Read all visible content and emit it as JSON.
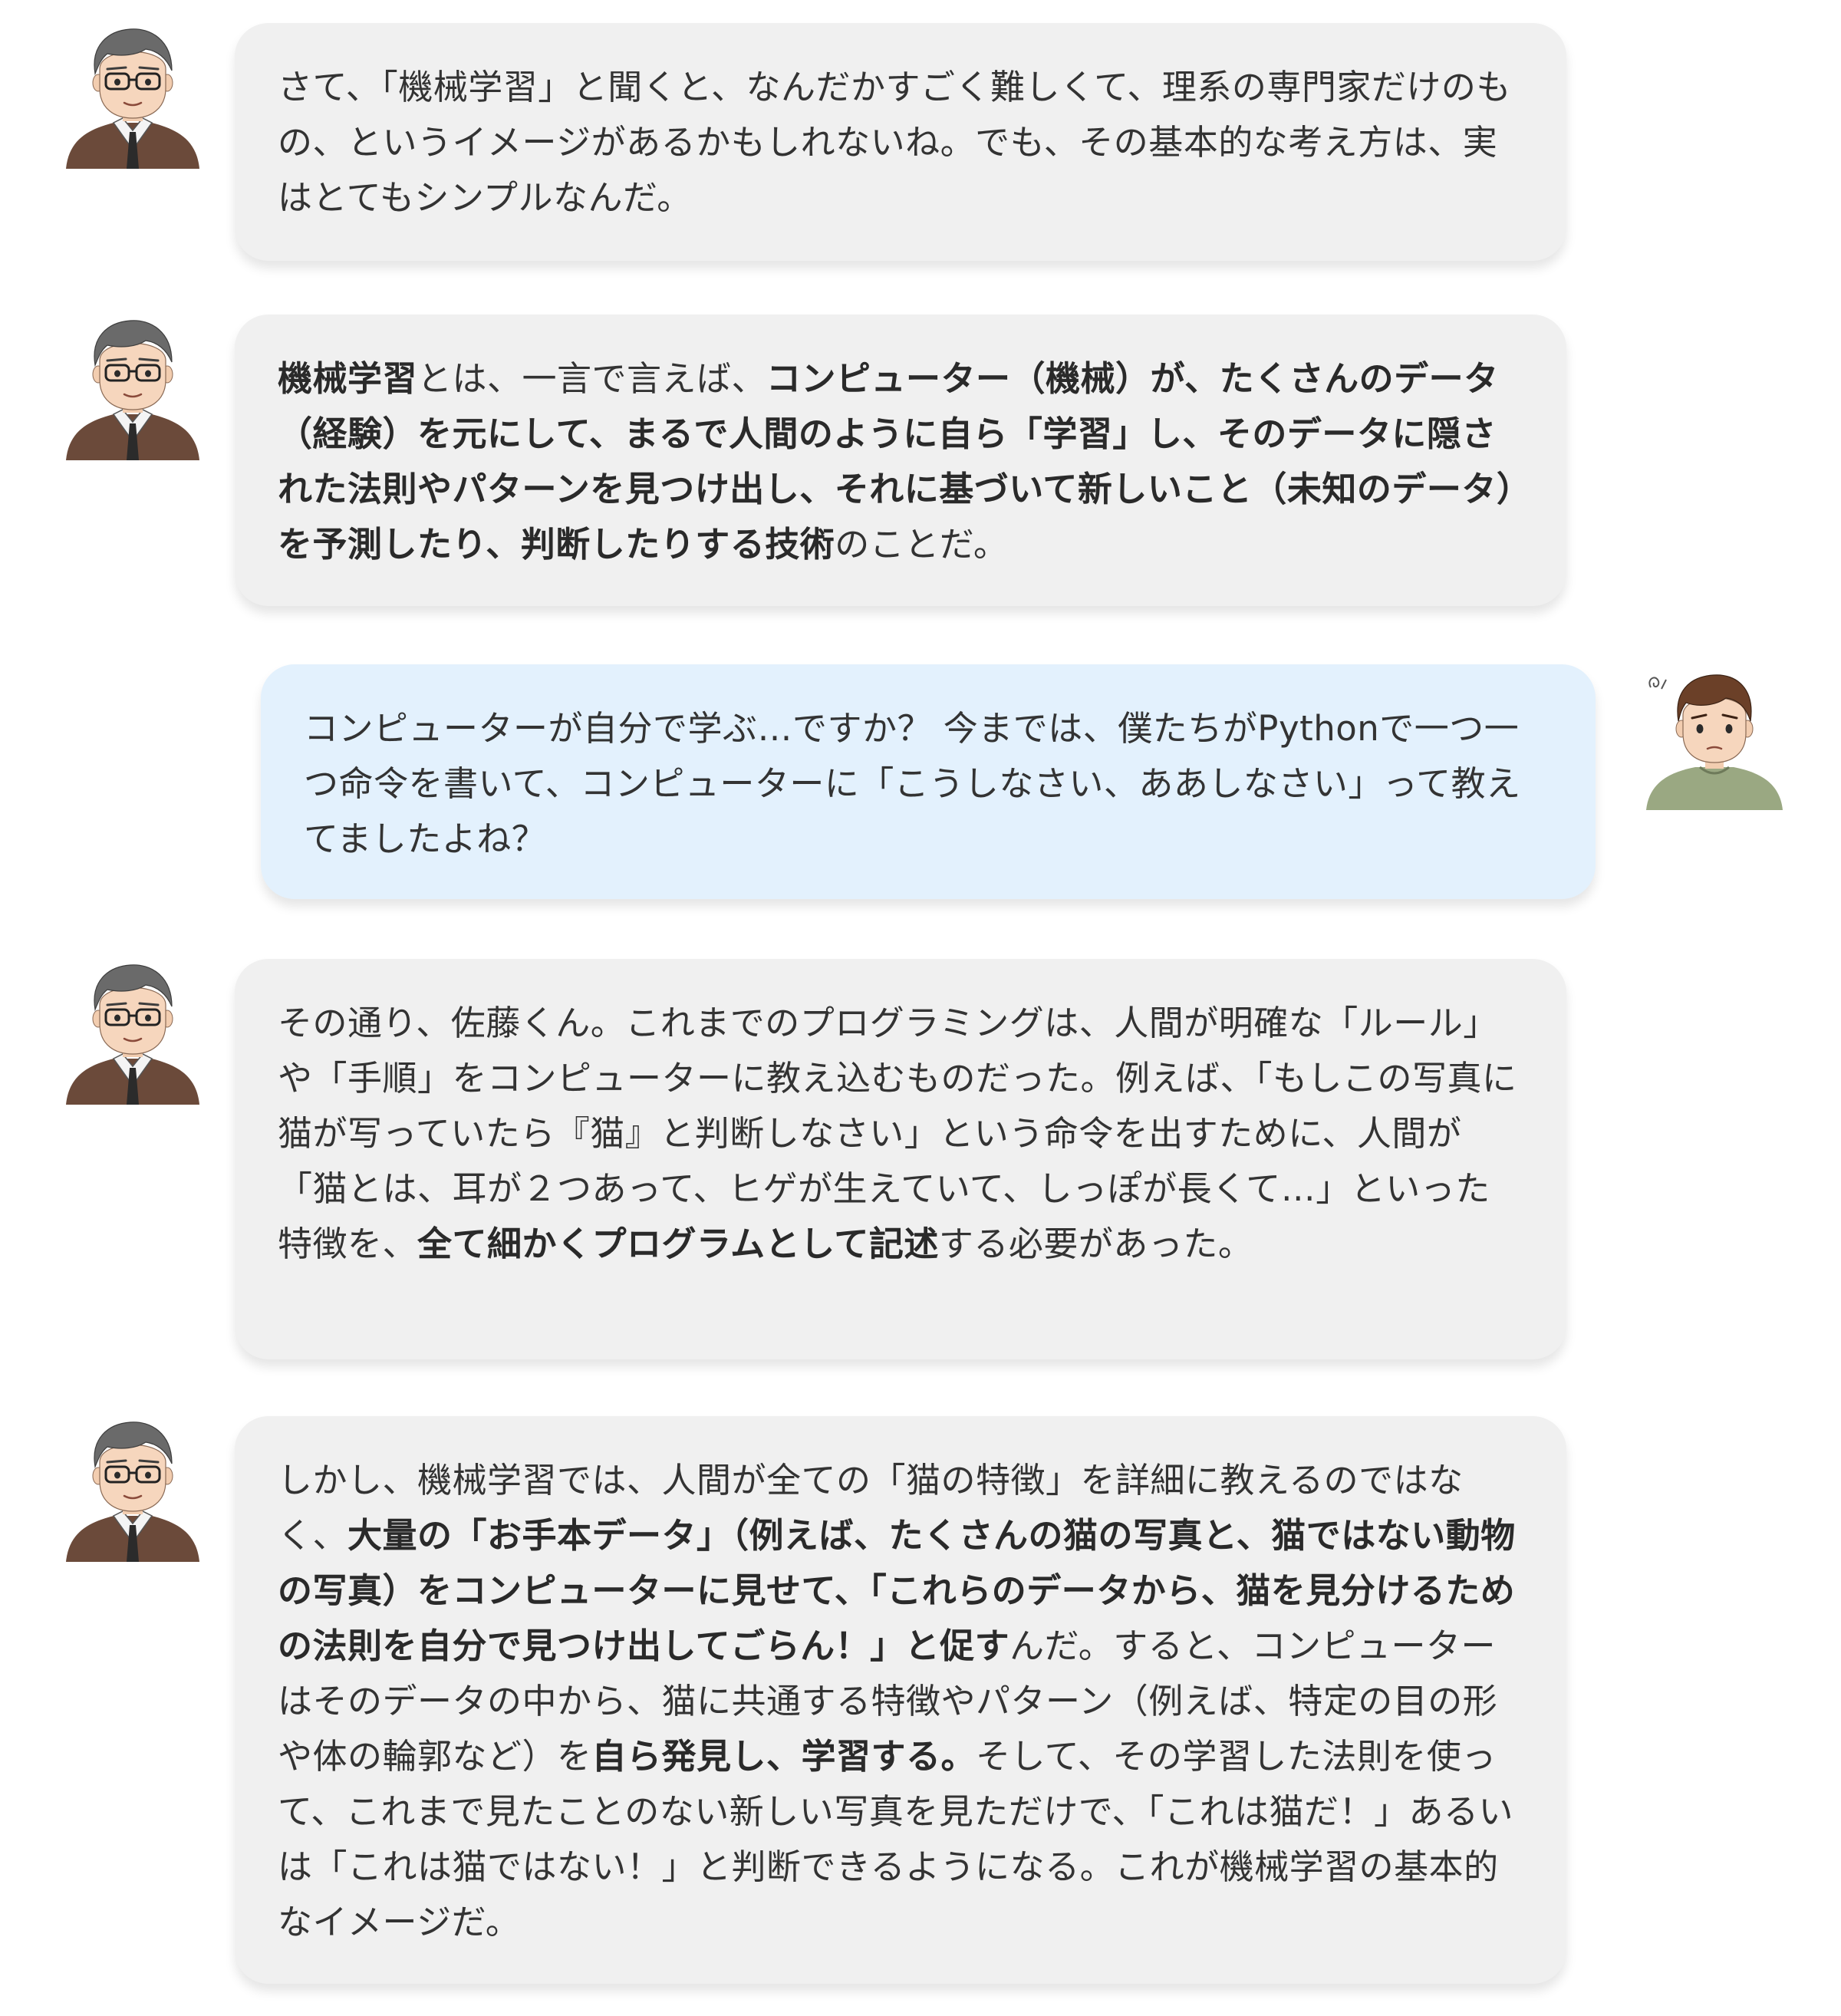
{
  "messages": [
    {
      "speaker": "teacher",
      "segments": [
        {
          "text": "さて、「機械学習」と聞くと、なんだかすごく難しくて、理系の専門家だけのもの、というイメージがあるかもしれないね。でも、その基本的な考え方は、実はとてもシンプルなんだ。",
          "bold": false
        }
      ]
    },
    {
      "speaker": "teacher",
      "segments": [
        {
          "text": "機械学習",
          "bold": true
        },
        {
          "text": "とは、一言で言えば、",
          "bold": false
        },
        {
          "text": "コンピューター（機械）が、たくさんのデータ（経験）を元にして、まるで人間のように自ら「学習」し、そのデータに隠された法則やパターンを見つけ出し、それに基づいて新しいこと（未知のデータ）を予測したり、判断したりする技術",
          "bold": true
        },
        {
          "text": "のことだ。",
          "bold": false
        }
      ]
    },
    {
      "speaker": "student",
      "segments": [
        {
          "text": "コンピューターが自分で学ぶ…ですか？ 今までは、僕たちがPythonで一つ一つ命令を書いて、コンピューターに「こうしなさい、ああしなさい」って教えてましたよね？",
          "bold": false
        }
      ]
    },
    {
      "speaker": "teacher",
      "segments": [
        {
          "text": "その通り、佐藤くん。これまでのプログラミングは、人間が明確な「ルール」や「手順」をコンピューターに教え込むものだった。例えば、「もしこの写真に猫が写っていたら『猫』と判断しなさい」という命令を出すために、人間が「猫とは、耳が２つあって、ヒゲが生えていて、しっぽが長くて…」といった特徴を、",
          "bold": false
        },
        {
          "text": "全て細かくプログラムとして記述",
          "bold": true
        },
        {
          "text": "する必要があった。",
          "bold": false
        }
      ]
    },
    {
      "speaker": "teacher",
      "segments": [
        {
          "text": "しかし、機械学習では、人間が全ての「猫の特徴」を詳細に教えるのではなく、",
          "bold": false
        },
        {
          "text": "大量の「お手本データ」（例えば、たくさんの猫の写真と、猫ではない動物の写真）をコンピューターに見せて、「これらのデータから、猫を見分けるための法則を自分で見つけ出してごらん！」と促す",
          "bold": true
        },
        {
          "text": "んだ。すると、コンピューターはそのデータの中から、猫に共通する特徴やパターン（例えば、特定の目の形や体の輪郭など）を",
          "bold": false
        },
        {
          "text": "自ら発見し、学習する。",
          "bold": true
        },
        {
          "text": "そして、その学習した法則を使って、これまで見たことのない新しい写真を見ただけで、「これは猫だ！」あるいは「これは猫ではない！」と判断できるようになる。これが機械学習の基本的なイメージだ。",
          "bold": false
        }
      ]
    }
  ],
  "colors": {
    "teacher_bubble": "#f0f0f0",
    "student_bubble": "#e3f1fd",
    "text": "#333333"
  },
  "icons": {
    "teacher_avatar": "teacher-avatar-icon",
    "student_avatar": "student-avatar-icon"
  }
}
